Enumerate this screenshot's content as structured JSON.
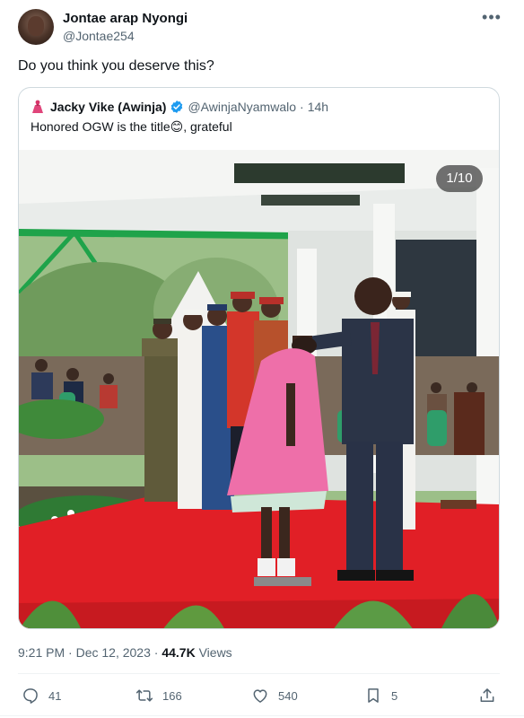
{
  "author": {
    "name": "Jontae arap Nyongi",
    "handle": "@Jontae254"
  },
  "tweet_text": "Do you think you deserve this?",
  "quoted": {
    "name": "Jacky Vike (Awinja)",
    "handle": "@AwinjaNyamwalo",
    "separator": "·",
    "time": "14h",
    "text": "Honored OGW is the title😊, grateful",
    "media_counter": "1/10"
  },
  "meta": {
    "time": "9:21 PM",
    "separator1": "·",
    "date": "Dec 12, 2023",
    "separator2": "·",
    "views_count": "44.7K",
    "views_label": "Views"
  },
  "actions": {
    "replies": "41",
    "retweets": "166",
    "likes": "540",
    "bookmarks": "5"
  },
  "icons": [
    "more-icon",
    "dress-emoji-icon",
    "verified-badge-icon",
    "reply-icon",
    "retweet-icon",
    "like-icon",
    "bookmark-icon",
    "share-icon"
  ],
  "colors": {
    "text": "#0f1419",
    "secondary": "#536471",
    "border": "#cfd9de",
    "verified": "#1d9bf0"
  }
}
